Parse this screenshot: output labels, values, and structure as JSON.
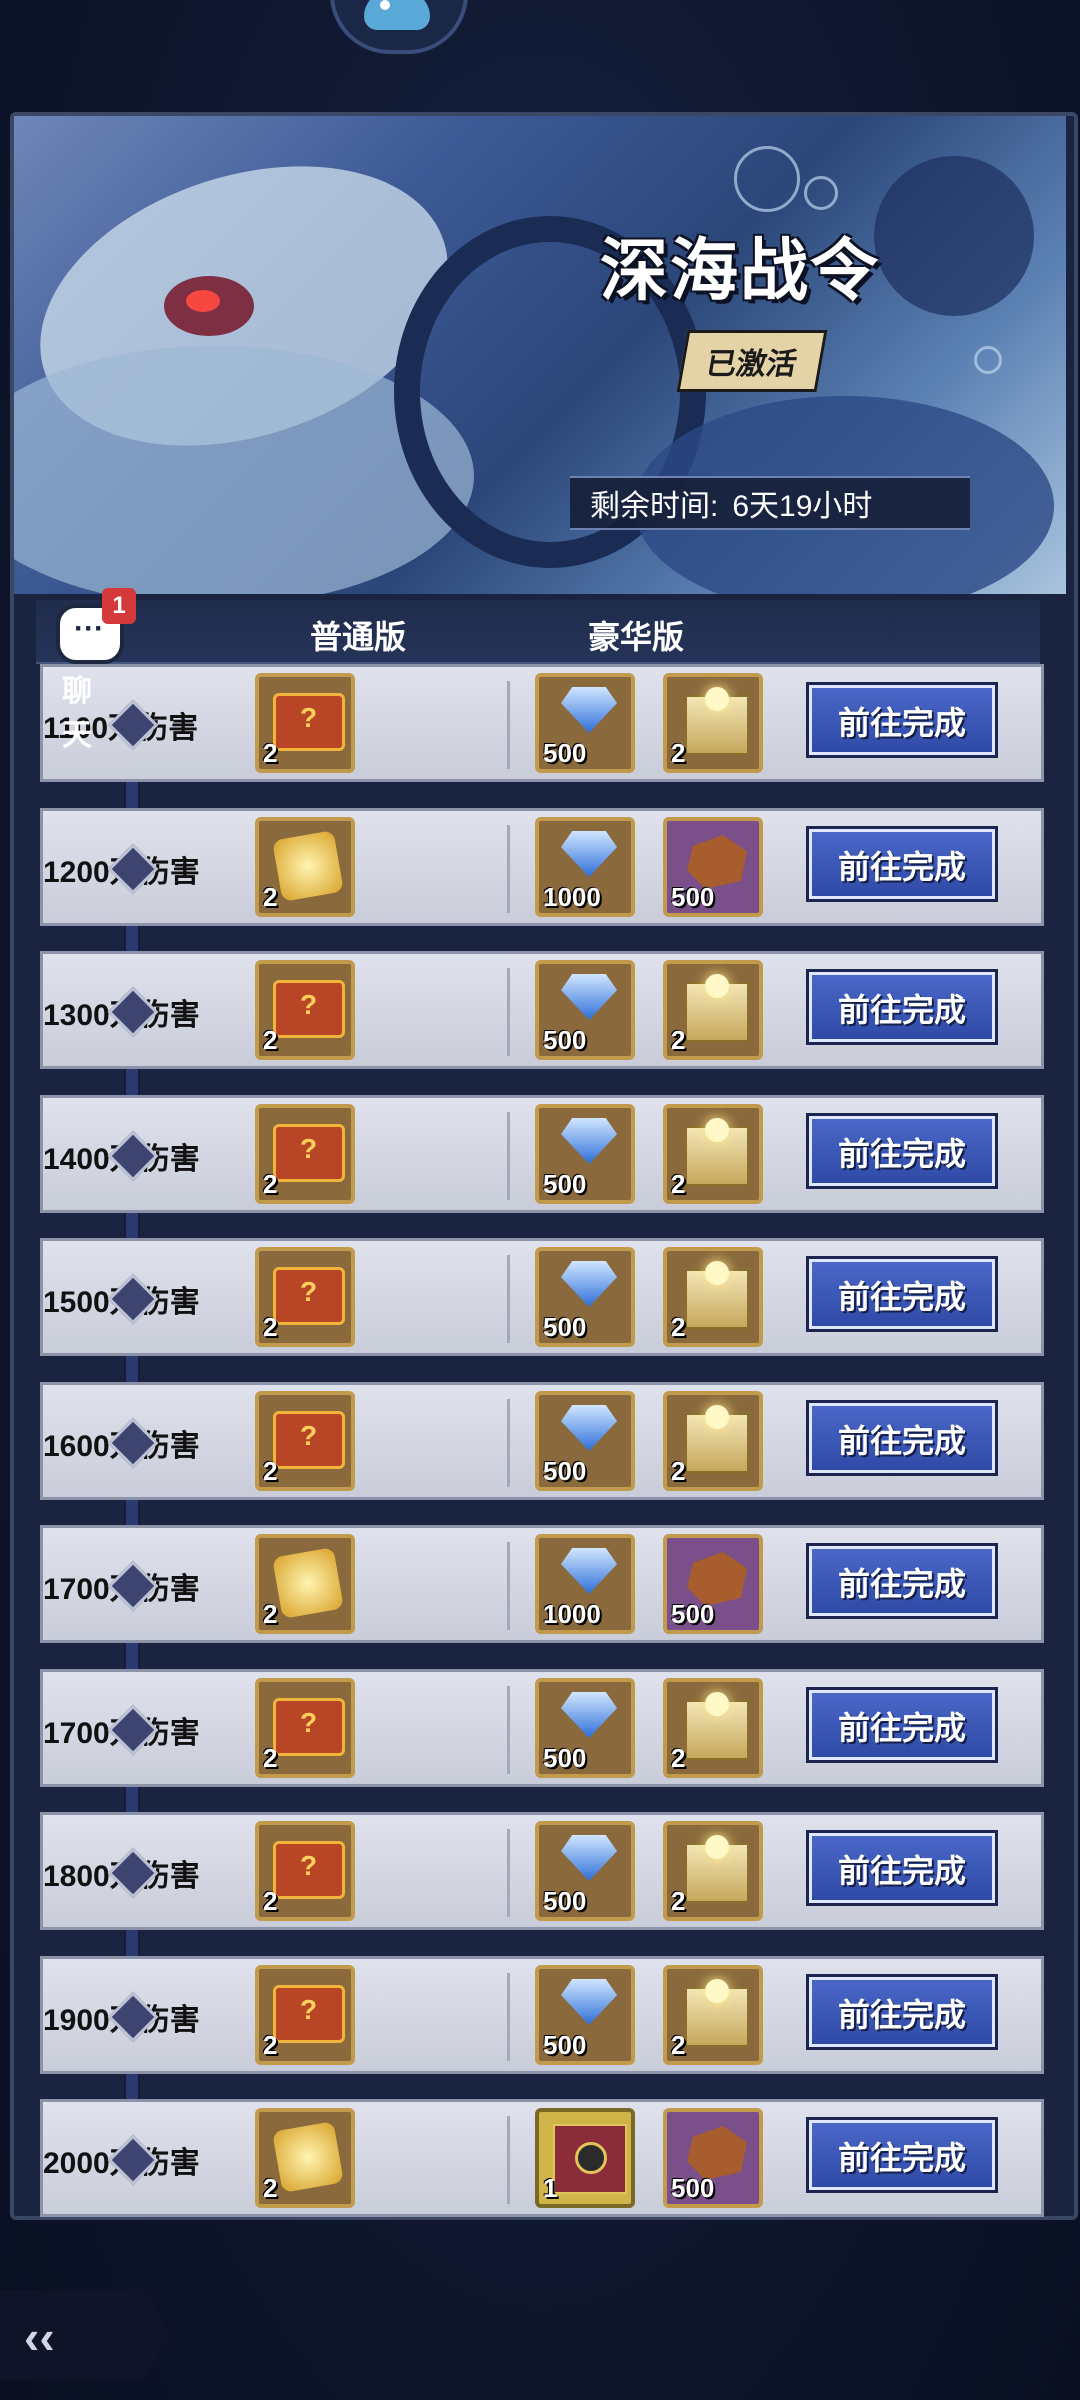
{
  "banner": {
    "title": "深海战令",
    "status_badge": "已激活",
    "timer_label": "剩余时间:",
    "timer_value": "6天19小时"
  },
  "columns": {
    "normal": "普通版",
    "deluxe": "豪华版"
  },
  "chat": {
    "label": "聊天",
    "unread_count": "1"
  },
  "go_button_label": "前往完成",
  "rows": [
    {
      "milestone": "1100万伤害",
      "normal": {
        "icon": "treasure-chest-icon",
        "qty": "2"
      },
      "deluxe": [
        {
          "icon": "blue-gem-icon",
          "qty": "500"
        },
        {
          "icon": "golden-giftbox-icon",
          "qty": "2"
        }
      ]
    },
    {
      "milestone": "1200万伤害",
      "normal": {
        "icon": "golden-scroll-icon",
        "qty": "2"
      },
      "deluxe": [
        {
          "icon": "blue-gem-icon",
          "qty": "1000"
        },
        {
          "icon": "ore-icon",
          "qty": "500"
        }
      ]
    },
    {
      "milestone": "1300万伤害",
      "normal": {
        "icon": "treasure-chest-icon",
        "qty": "2"
      },
      "deluxe": [
        {
          "icon": "blue-gem-icon",
          "qty": "500"
        },
        {
          "icon": "golden-giftbox-icon",
          "qty": "2"
        }
      ]
    },
    {
      "milestone": "1400万伤害",
      "normal": {
        "icon": "treasure-chest-icon",
        "qty": "2"
      },
      "deluxe": [
        {
          "icon": "blue-gem-icon",
          "qty": "500"
        },
        {
          "icon": "golden-giftbox-icon",
          "qty": "2"
        }
      ]
    },
    {
      "milestone": "1500万伤害",
      "normal": {
        "icon": "treasure-chest-icon",
        "qty": "2"
      },
      "deluxe": [
        {
          "icon": "blue-gem-icon",
          "qty": "500"
        },
        {
          "icon": "golden-giftbox-icon",
          "qty": "2"
        }
      ]
    },
    {
      "milestone": "1600万伤害",
      "normal": {
        "icon": "treasure-chest-icon",
        "qty": "2"
      },
      "deluxe": [
        {
          "icon": "blue-gem-icon",
          "qty": "500"
        },
        {
          "icon": "golden-giftbox-icon",
          "qty": "2"
        }
      ]
    },
    {
      "milestone": "1700万伤害",
      "normal": {
        "icon": "golden-scroll-icon",
        "qty": "2"
      },
      "deluxe": [
        {
          "icon": "blue-gem-icon",
          "qty": "1000"
        },
        {
          "icon": "ore-icon",
          "qty": "500"
        }
      ]
    },
    {
      "milestone": "1700万伤害",
      "normal": {
        "icon": "treasure-chest-icon",
        "qty": "2"
      },
      "deluxe": [
        {
          "icon": "blue-gem-icon",
          "qty": "500"
        },
        {
          "icon": "golden-giftbox-icon",
          "qty": "2"
        }
      ]
    },
    {
      "milestone": "1800万伤害",
      "normal": {
        "icon": "treasure-chest-icon",
        "qty": "2"
      },
      "deluxe": [
        {
          "icon": "blue-gem-icon",
          "qty": "500"
        },
        {
          "icon": "golden-giftbox-icon",
          "qty": "2"
        }
      ]
    },
    {
      "milestone": "1900万伤害",
      "normal": {
        "icon": "treasure-chest-icon",
        "qty": "2"
      },
      "deluxe": [
        {
          "icon": "blue-gem-icon",
          "qty": "500"
        },
        {
          "icon": "golden-giftbox-icon",
          "qty": "2"
        }
      ]
    },
    {
      "milestone": "2000万伤害",
      "normal": {
        "icon": "golden-scroll-icon",
        "qty": "2"
      },
      "deluxe": [
        {
          "icon": "present-box-icon",
          "qty": "1"
        },
        {
          "icon": "ore-icon",
          "qty": "500"
        }
      ]
    }
  ]
}
